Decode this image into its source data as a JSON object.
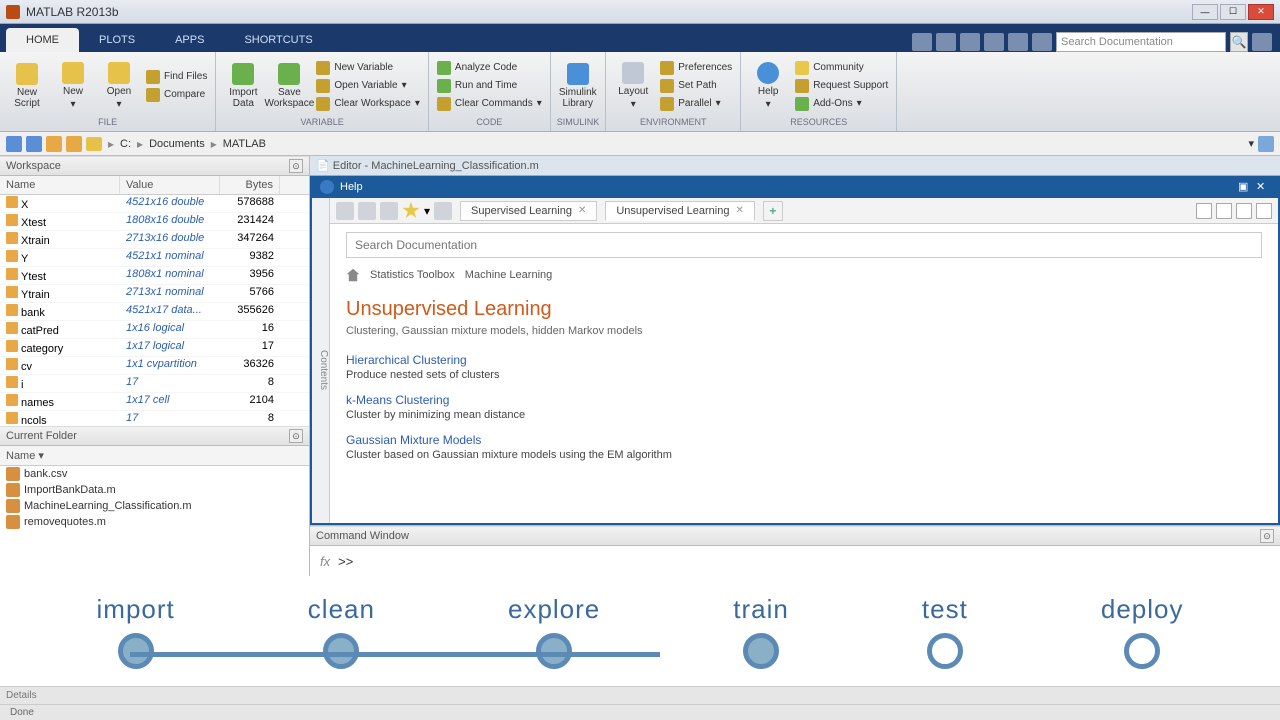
{
  "titlebar": {
    "text": "MATLAB R2013b"
  },
  "ribbon": {
    "tabs": [
      "HOME",
      "PLOTS",
      "APPS",
      "SHORTCUTS"
    ],
    "active_tab": 0,
    "search_placeholder": "Search Documentation",
    "groups": {
      "file": {
        "label": "FILE",
        "new_script": "New\nScript",
        "new": "New",
        "open": "Open",
        "find_files": "Find Files",
        "compare": "Compare"
      },
      "variable": {
        "label": "VARIABLE",
        "import_data": "Import\nData",
        "save_workspace": "Save\nWorkspace",
        "new_var": "New Variable",
        "open_var": "Open Variable",
        "clear_ws": "Clear Workspace"
      },
      "code": {
        "label": "CODE",
        "analyze": "Analyze Code",
        "run_time": "Run and Time",
        "clear_cmd": "Clear Commands"
      },
      "simulink": {
        "label": "SIMULINK",
        "lib": "Simulink\nLibrary"
      },
      "environment": {
        "label": "ENVIRONMENT",
        "layout": "Layout",
        "prefs": "Preferences",
        "set_path": "Set Path",
        "parallel": "Parallel"
      },
      "resources": {
        "label": "RESOURCES",
        "help": "Help",
        "community": "Community",
        "support": "Request Support",
        "addons": "Add-Ons"
      }
    }
  },
  "breadcrumb": {
    "drive": "C:",
    "parts": [
      "Documents",
      "MATLAB"
    ]
  },
  "workspace": {
    "title": "Workspace",
    "cols": [
      "Name",
      "Value",
      "Bytes"
    ],
    "rows": [
      {
        "name": "X",
        "value": "4521x16 double",
        "bytes": "578688"
      },
      {
        "name": "Xtest",
        "value": "1808x16 double",
        "bytes": "231424"
      },
      {
        "name": "Xtrain",
        "value": "2713x16 double",
        "bytes": "347264"
      },
      {
        "name": "Y",
        "value": "4521x1 nominal",
        "bytes": "9382"
      },
      {
        "name": "Ytest",
        "value": "1808x1 nominal",
        "bytes": "3956"
      },
      {
        "name": "Ytrain",
        "value": "2713x1 nominal",
        "bytes": "5766"
      },
      {
        "name": "bank",
        "value": "4521x17 data...",
        "bytes": "355626"
      },
      {
        "name": "catPred",
        "value": "1x16 logical",
        "bytes": "16"
      },
      {
        "name": "category",
        "value": "1x17 logical",
        "bytes": "17"
      },
      {
        "name": "cv",
        "value": "1x1 cvpartition",
        "bytes": "36326"
      },
      {
        "name": "i",
        "value": "17",
        "bytes": "8"
      },
      {
        "name": "names",
        "value": "1x17 cell",
        "bytes": "2104"
      },
      {
        "name": "ncols",
        "value": "17",
        "bytes": "8"
      }
    ]
  },
  "current_folder": {
    "title": "Current Folder",
    "col": "Name",
    "files": [
      "bank.csv",
      "ImportBankData.m",
      "MachineLearning_Classification.m",
      "removequotes.m"
    ]
  },
  "editor": {
    "title": "Editor - MachineLearning_Classification.m"
  },
  "help": {
    "title": "Help",
    "tabs": [
      {
        "label": "Supervised Learning",
        "active": false
      },
      {
        "label": "Unsupervised Learning",
        "active": true
      }
    ],
    "sidebar": "Contents",
    "search_placeholder": "Search Documentation",
    "crumbs": [
      "Statistics Toolbox",
      "Machine Learning"
    ],
    "page_title": "Unsupervised Learning",
    "page_subtitle": "Clustering, Gaussian mixture models, hidden Markov models",
    "sections": [
      {
        "link": "Hierarchical Clustering",
        "desc": "Produce nested sets of clusters"
      },
      {
        "link": "k-Means Clustering",
        "desc": "Cluster by minimizing mean distance"
      },
      {
        "link": "Gaussian Mixture Models",
        "desc": "Cluster based on Gaussian mixture models using the EM algorithm"
      }
    ]
  },
  "command_window": {
    "title": "Command Window",
    "fx": "fx",
    "prompt": ">>"
  },
  "workflow": {
    "steps": [
      {
        "label": "import",
        "filled": true
      },
      {
        "label": "clean",
        "filled": true
      },
      {
        "label": "explore",
        "filled": true
      },
      {
        "label": "train",
        "filled": true
      },
      {
        "label": "test",
        "filled": false
      },
      {
        "label": "deploy",
        "filled": false
      }
    ]
  },
  "details": {
    "label": "Details"
  },
  "status": {
    "text": "Done"
  }
}
